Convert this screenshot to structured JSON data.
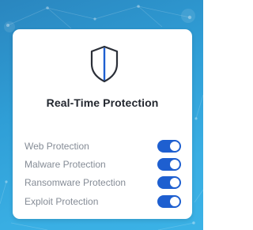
{
  "card": {
    "title": "Real-Time Protection",
    "icon": "shield-icon"
  },
  "settings": [
    {
      "label": "Web Protection",
      "enabled": true
    },
    {
      "label": "Malware Protection",
      "enabled": true
    },
    {
      "label": "Ransomware Protection",
      "enabled": true
    },
    {
      "label": "Exploit Protection",
      "enabled": true
    }
  ],
  "colors": {
    "background": "#2f9ed6",
    "card": "#ffffff",
    "toggle_on": "#1e5fd0",
    "shield_outline": "#2b2f38",
    "shield_accent": "#1e5fd0",
    "title_text": "#23272f",
    "label_text": "#858c96"
  }
}
